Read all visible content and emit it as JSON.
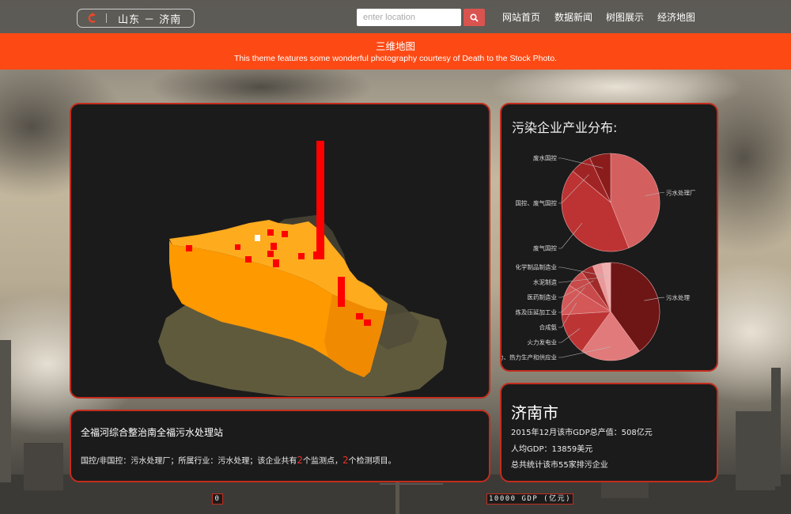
{
  "brand": {
    "location": "山东 － 济南"
  },
  "search": {
    "placeholder": "enter location"
  },
  "nav": [
    {
      "label": "网站首页"
    },
    {
      "label": "数据新闻"
    },
    {
      "label": "树图展示"
    },
    {
      "label": "经济地图"
    }
  ],
  "banner": {
    "title": "三维地图",
    "subtitle": "This theme features some wonderful photography courtesy of Death to the Stock Photo."
  },
  "pie_panel": {
    "title": "污染企业产业分布:"
  },
  "chart_data": [
    {
      "type": "pie",
      "title": "",
      "slices": [
        {
          "label": "污水处理厂",
          "value": 44
        },
        {
          "label": "废气国控",
          "value": 42
        },
        {
          "label": "国控、废气国控",
          "value": 7
        },
        {
          "label": "废水国控",
          "value": 7
        }
      ]
    },
    {
      "type": "pie",
      "title": "",
      "slices": [
        {
          "label": "污水处理",
          "value": 40
        },
        {
          "label": "电力、热力生产和供应业",
          "value": 20
        },
        {
          "label": "火力发电业",
          "value": 14
        },
        {
          "label": "合成氨",
          "value": 10
        },
        {
          "label": "炼及压延加工业",
          "value": 6
        },
        {
          "label": "医药制造业",
          "value": 4
        },
        {
          "label": "水泥制造",
          "value": 3
        },
        {
          "label": "化学制品制造业",
          "value": 3
        }
      ]
    }
  ],
  "colors": {
    "accent": "#fd4a15",
    "panel_border": "#c32d1e",
    "panel_bg": "#1b1b1b",
    "map_fill": "#ff9900",
    "map_bar": "#ff0000"
  },
  "city": {
    "name": "济南市",
    "gdp": "2015年12月该市GDP总产值：508亿元",
    "per_capita": "人均GDP：13859美元",
    "enterprises": "总共统计该市55家排污企业"
  },
  "site": {
    "name": "全福河综合整治南全福污水处理站",
    "text_a": "国控/非国控：污水处理厂；所属行业：污水处理；该企业共有",
    "monitor_points": "2",
    "text_b": "个监测点，",
    "monitor_items": "2",
    "text_c": "个检测项目。"
  },
  "legend": {
    "min": "0",
    "max": "10000 GDP (亿元)"
  }
}
